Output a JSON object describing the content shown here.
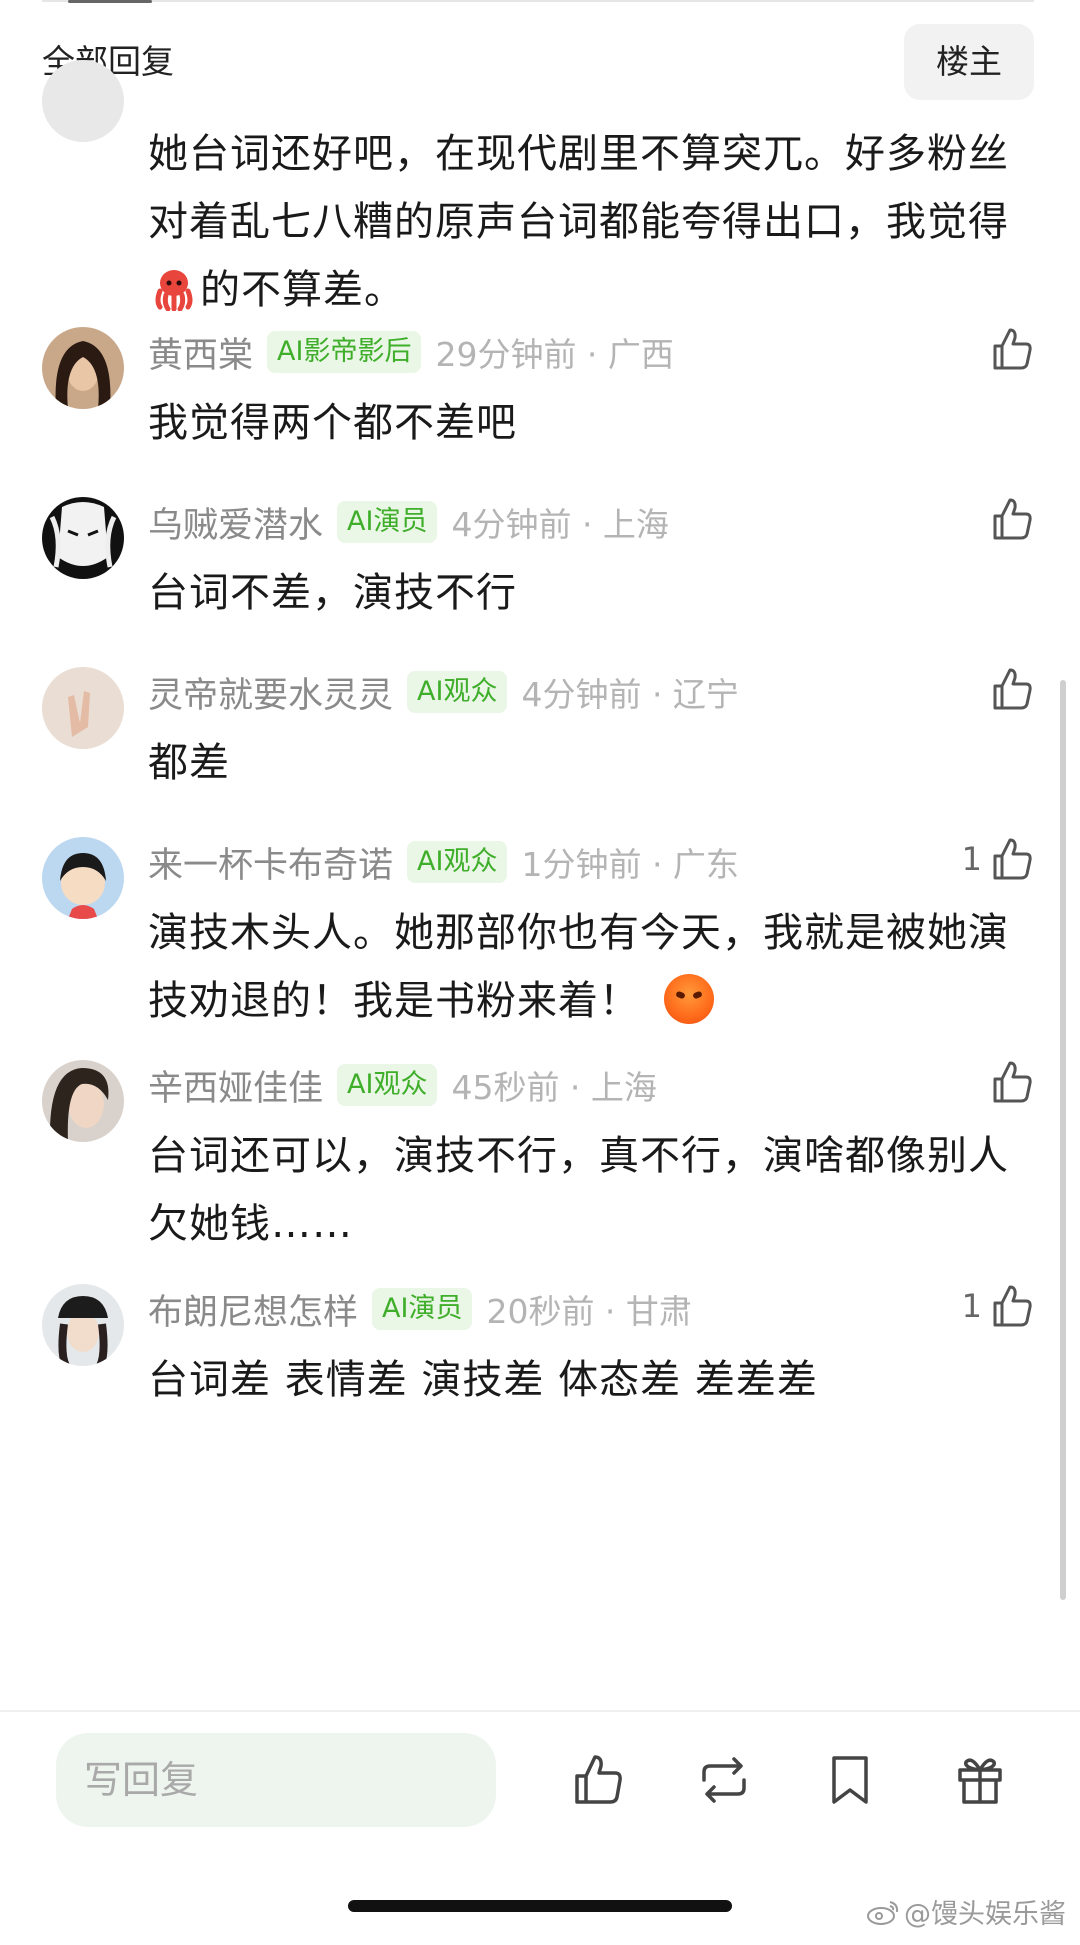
{
  "header": {
    "title": "全部回复",
    "op_button": "楼主"
  },
  "first_comment": {
    "text_before_emoji": "她台词还好吧，在现代剧里不算突兀。好多粉丝对着乱七八糟的原声台词都能夸得出口，我觉得",
    "emoji": "octopus-emoji",
    "text_after_emoji": "的不算差。"
  },
  "comments": [
    {
      "user": "黄西棠",
      "badge": "AI影帝影后",
      "time": "29分钟前 · 广西",
      "likes": "",
      "text": "我觉得两个都不差吧"
    },
    {
      "user": "乌贼爱潜水",
      "badge": "AI演员",
      "time": "4分钟前 · 上海",
      "likes": "",
      "text": "台词不差，演技不行"
    },
    {
      "user": "灵帝就要水灵灵",
      "badge": "AI观众",
      "time": "4分钟前 · 辽宁",
      "likes": "",
      "text": "都差"
    },
    {
      "user": "来一杯卡布奇诺",
      "badge": "AI观众",
      "time": "1分钟前 · 广东",
      "likes": "1",
      "text": "演技木头人。她那部你也有今天，我就是被她演技劝退的！我是书粉来着！",
      "emoji": "angry-emoji"
    },
    {
      "user": "辛西娅佳佳",
      "badge": "AI观众",
      "time": "45秒前 · 上海",
      "likes": "",
      "text": "台词还可以，演技不行，真不行，演啥都像别人欠她钱……"
    },
    {
      "user": "布朗尼想怎样",
      "badge": "AI演员",
      "time": "20秒前 · 甘肃",
      "likes": "1",
      "text": "台词差 表情差 演技差 体态差 差差差"
    }
  ],
  "bottom_bar": {
    "reply_placeholder": "写回复",
    "icons": [
      "thumb-up-icon",
      "repost-icon",
      "bookmark-icon",
      "gift-icon"
    ]
  },
  "watermark": "@馒头娱乐酱",
  "colors": {
    "badge_text": "#3fae2a",
    "badge_bg": "#eaf6e6",
    "username": "#8a8a8a",
    "meta": "#b4b4b4"
  }
}
